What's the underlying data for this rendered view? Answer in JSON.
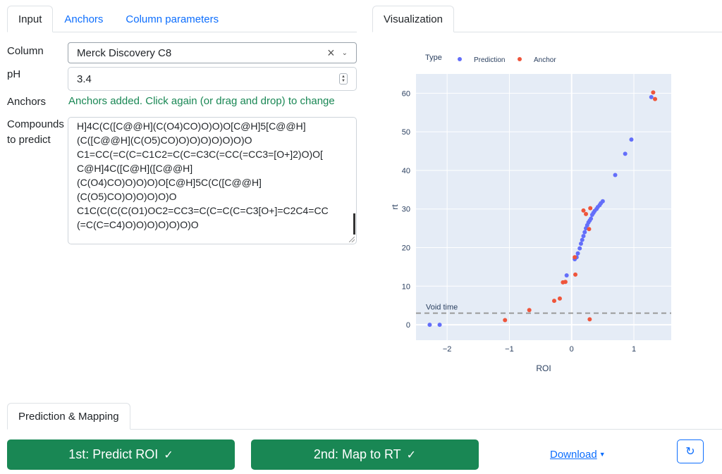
{
  "input_tabs": [
    {
      "label": "Input",
      "active": true
    },
    {
      "label": "Anchors",
      "active": false
    },
    {
      "label": "Column parameters",
      "active": false
    }
  ],
  "viz_tabs": [
    {
      "label": "Visualization",
      "active": true
    }
  ],
  "pred_tabs": [
    {
      "label": "Prediction & Mapping",
      "active": true
    }
  ],
  "form": {
    "column_label": "Column",
    "column_value": "Merck Discovery C8",
    "ph_label": "pH",
    "ph_value": "3.4",
    "anchors_label": "Anchors",
    "anchors_message": "Anchors added. Click again (or drag and drop) to change",
    "compounds_label_1": "Compounds",
    "compounds_label_2": "to predict",
    "compounds_lines": [
      "H]4C(C([C@@H](C(O4)CO)O)O)O[C@H]5[C@@H]",
      "(C([C@@H](C(O5)CO)O)O)O)O)O)O)O",
      "C1=CC(=C(C=C1C2=C(C=C3C(=CC(=CC3=[O+]2)O)O[",
      "C@H]4C([C@H]([C@@H]",
      "(C(O4)CO)O)O)O)O[C@H]5C(C([C@@H]",
      "(C(O5)CO)O)O)O)O)O",
      "C1C(C(C(C(O1)OC2=CC3=C(C=C(C=C3[O+]=C2C4=CC",
      "(=C(C=C4)O)O)O)O)O)O)O"
    ]
  },
  "chart_data": {
    "type": "scatter",
    "xlabel": "ROI",
    "ylabel": "rt",
    "xlim": [
      -2.5,
      1.6
    ],
    "ylim": [
      -4,
      65
    ],
    "x_ticks": [
      -2,
      -1,
      0,
      1
    ],
    "y_ticks": [
      0,
      10,
      20,
      30,
      40,
      50,
      60
    ],
    "legend_title": "Type",
    "legend_position": "top",
    "grid": true,
    "plot_bg": "#e5ecf6",
    "void_time": {
      "label": "Void time",
      "y": 3
    },
    "series": [
      {
        "name": "Prediction",
        "color": "#636efa",
        "x": [
          -2.28,
          -2.12,
          -0.08,
          0.05,
          0.08,
          0.1,
          0.13,
          0.15,
          0.17,
          0.19,
          0.21,
          0.23,
          0.25,
          0.27,
          0.29,
          0.31,
          0.33,
          0.35,
          0.37,
          0.4,
          0.42,
          0.45,
          0.47,
          0.5,
          0.7,
          0.86,
          0.96,
          1.28
        ],
        "y": [
          0,
          0,
          12.8,
          17,
          17.5,
          18.5,
          19.8,
          21,
          22,
          23,
          24,
          25,
          25.8,
          26.5,
          27,
          27.5,
          28.5,
          29,
          29.5,
          30,
          30.5,
          31,
          31.5,
          32,
          38.8,
          44.3,
          48,
          59
        ]
      },
      {
        "name": "Anchor",
        "color": "#ef553b",
        "x": [
          -1.07,
          -0.68,
          -0.28,
          -0.19,
          -0.14,
          -0.1,
          0.05,
          0.06,
          0.19,
          0.23,
          0.28,
          0.29,
          0.3,
          1.31,
          1.34
        ],
        "y": [
          1.2,
          3.8,
          6.2,
          6.8,
          11,
          11.1,
          17.5,
          13,
          29.6,
          28.7,
          24.8,
          1.4,
          30.2,
          60.2,
          58.5
        ]
      }
    ]
  },
  "buttons": {
    "predict": "1st: Predict ROI",
    "map": "2nd: Map to RT",
    "download": "Download"
  }
}
